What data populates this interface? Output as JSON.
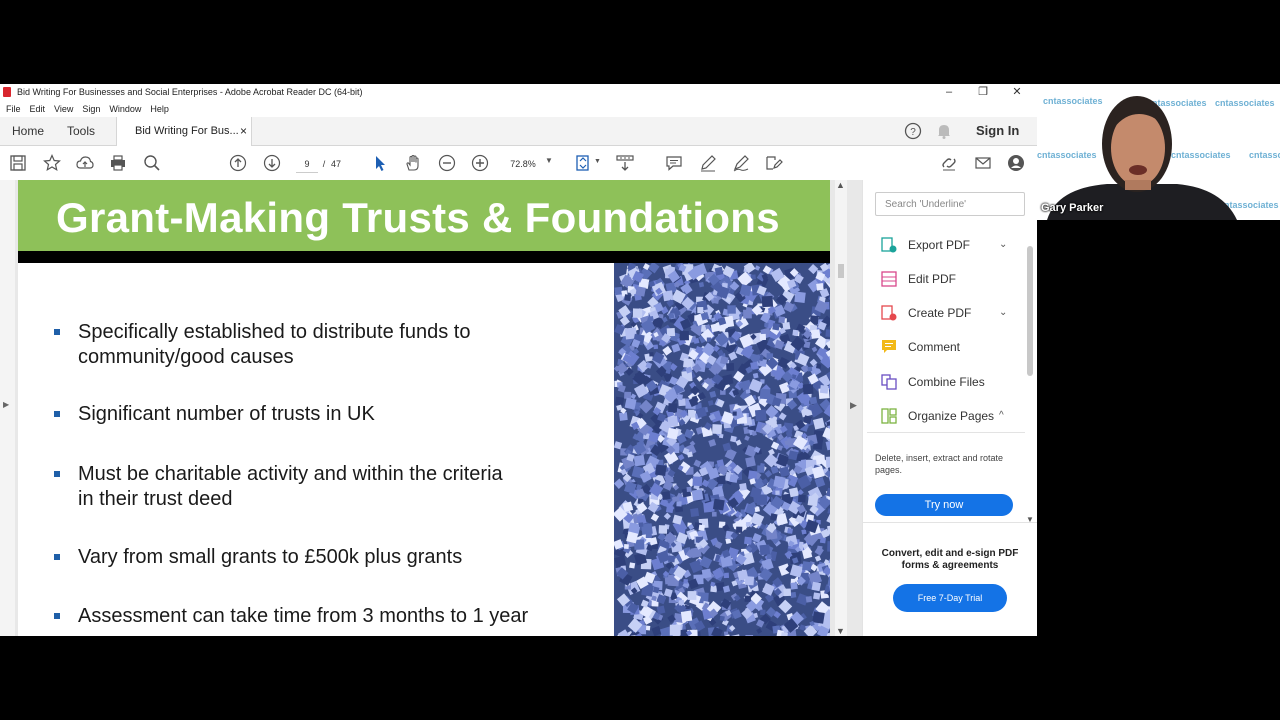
{
  "window": {
    "title": "Bid Writing For Businesses and Social Enterprises - Adobe Acrobat Reader DC (64-bit)",
    "minimize": "–",
    "restore": "❐",
    "close": "✕"
  },
  "menu": [
    "File",
    "Edit",
    "View",
    "Sign",
    "Window",
    "Help"
  ],
  "tabs": {
    "home": "Home",
    "tools": "Tools",
    "doc_tab": "Bid Writing For Bus...",
    "doc_tab_close": "×",
    "sign_in": "Sign In"
  },
  "toolbar": {
    "page_current": "9",
    "page_separator": "/",
    "page_total": "47",
    "zoom": "72.8%"
  },
  "slide": {
    "title": "Grant-Making Trusts & Foundations",
    "bullets": [
      [
        "Specifically established to distribute funds to",
        "community/good causes"
      ],
      [
        "Significant number of trusts in UK"
      ],
      [
        "Must be charitable activity and within the criteria",
        "in their trust deed"
      ],
      [
        "Vary from small grants to £500k plus grants"
      ],
      [
        "Assessment can take time from 3 months to 1 year"
      ]
    ]
  },
  "right_pane": {
    "search_placeholder": "Search 'Underline'",
    "tools": [
      {
        "label": "Export PDF",
        "icon": "export-pdf-icon",
        "expander": "⌄"
      },
      {
        "label": "Edit PDF",
        "icon": "edit-pdf-icon",
        "expander": ""
      },
      {
        "label": "Create PDF",
        "icon": "create-pdf-icon",
        "expander": "⌄"
      },
      {
        "label": "Comment",
        "icon": "comment-icon",
        "expander": ""
      },
      {
        "label": "Combine Files",
        "icon": "combine-files-icon",
        "expander": ""
      },
      {
        "label": "Organize Pages",
        "icon": "organize-pages-icon",
        "expander": "^"
      }
    ],
    "organize_desc": "Delete, insert, extract and rotate pages.",
    "try_now": "Try now",
    "promo": "Convert, edit and e-sign PDF forms & agreements",
    "trial_button": "Free 7-Day Trial"
  },
  "webcam": {
    "name": "Gary Parker",
    "watermark": "cntassociates"
  },
  "colors": {
    "slide_header": "#8ec159",
    "bullet": "#1f5fa8",
    "acrobat_blue": "#1473e6"
  }
}
